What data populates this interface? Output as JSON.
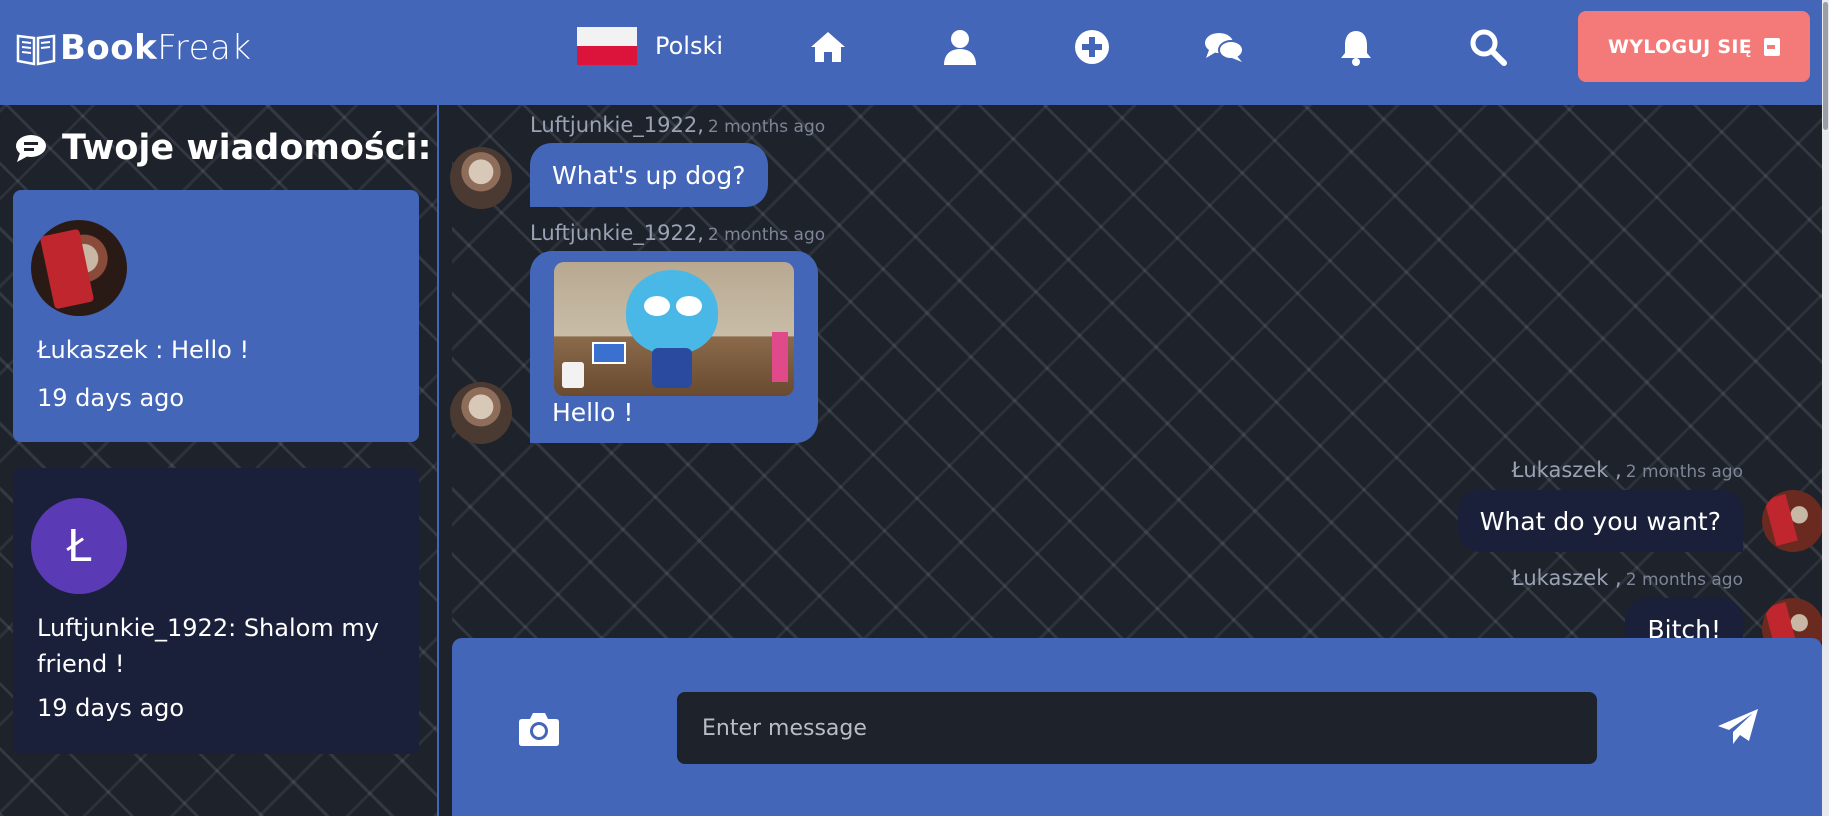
{
  "header": {
    "logo": {
      "part1": "Book",
      "part2": "Freak"
    },
    "language": "Polski",
    "logout_label": "WYLOGUJ SIĘ",
    "accent_color": "#4466b8",
    "logout_color": "#f47979",
    "nav_icons": [
      "home-icon",
      "user-icon",
      "add-icon",
      "chat-icon",
      "bell-icon",
      "search-icon"
    ]
  },
  "sidebar": {
    "title": "Twoje wiadomości:",
    "conversations": [
      {
        "preview": "Łukaszek : Hello !",
        "time": "19 days ago",
        "avatar": "photo"
      },
      {
        "preview": "Luftjunkie_1922: Shalom my friend !",
        "time": "19 days ago",
        "avatar_letter": "Ł"
      }
    ]
  },
  "messages": [
    {
      "author": "Luftjunkie_1922,",
      "time": "2 months ago",
      "text": "What's up dog?",
      "direction": "in"
    },
    {
      "author": "Luftjunkie_1922,",
      "time": "2 months ago",
      "text": "Hello !",
      "direction": "in",
      "has_image": true
    },
    {
      "author": "Łukaszek ,",
      "time": "2 months ago",
      "text": "What do you want?",
      "direction": "out"
    },
    {
      "author": "Łukaszek ,",
      "time": "2 months ago",
      "text": "Bitch!",
      "direction": "out"
    }
  ],
  "composer": {
    "placeholder": "Enter message"
  }
}
